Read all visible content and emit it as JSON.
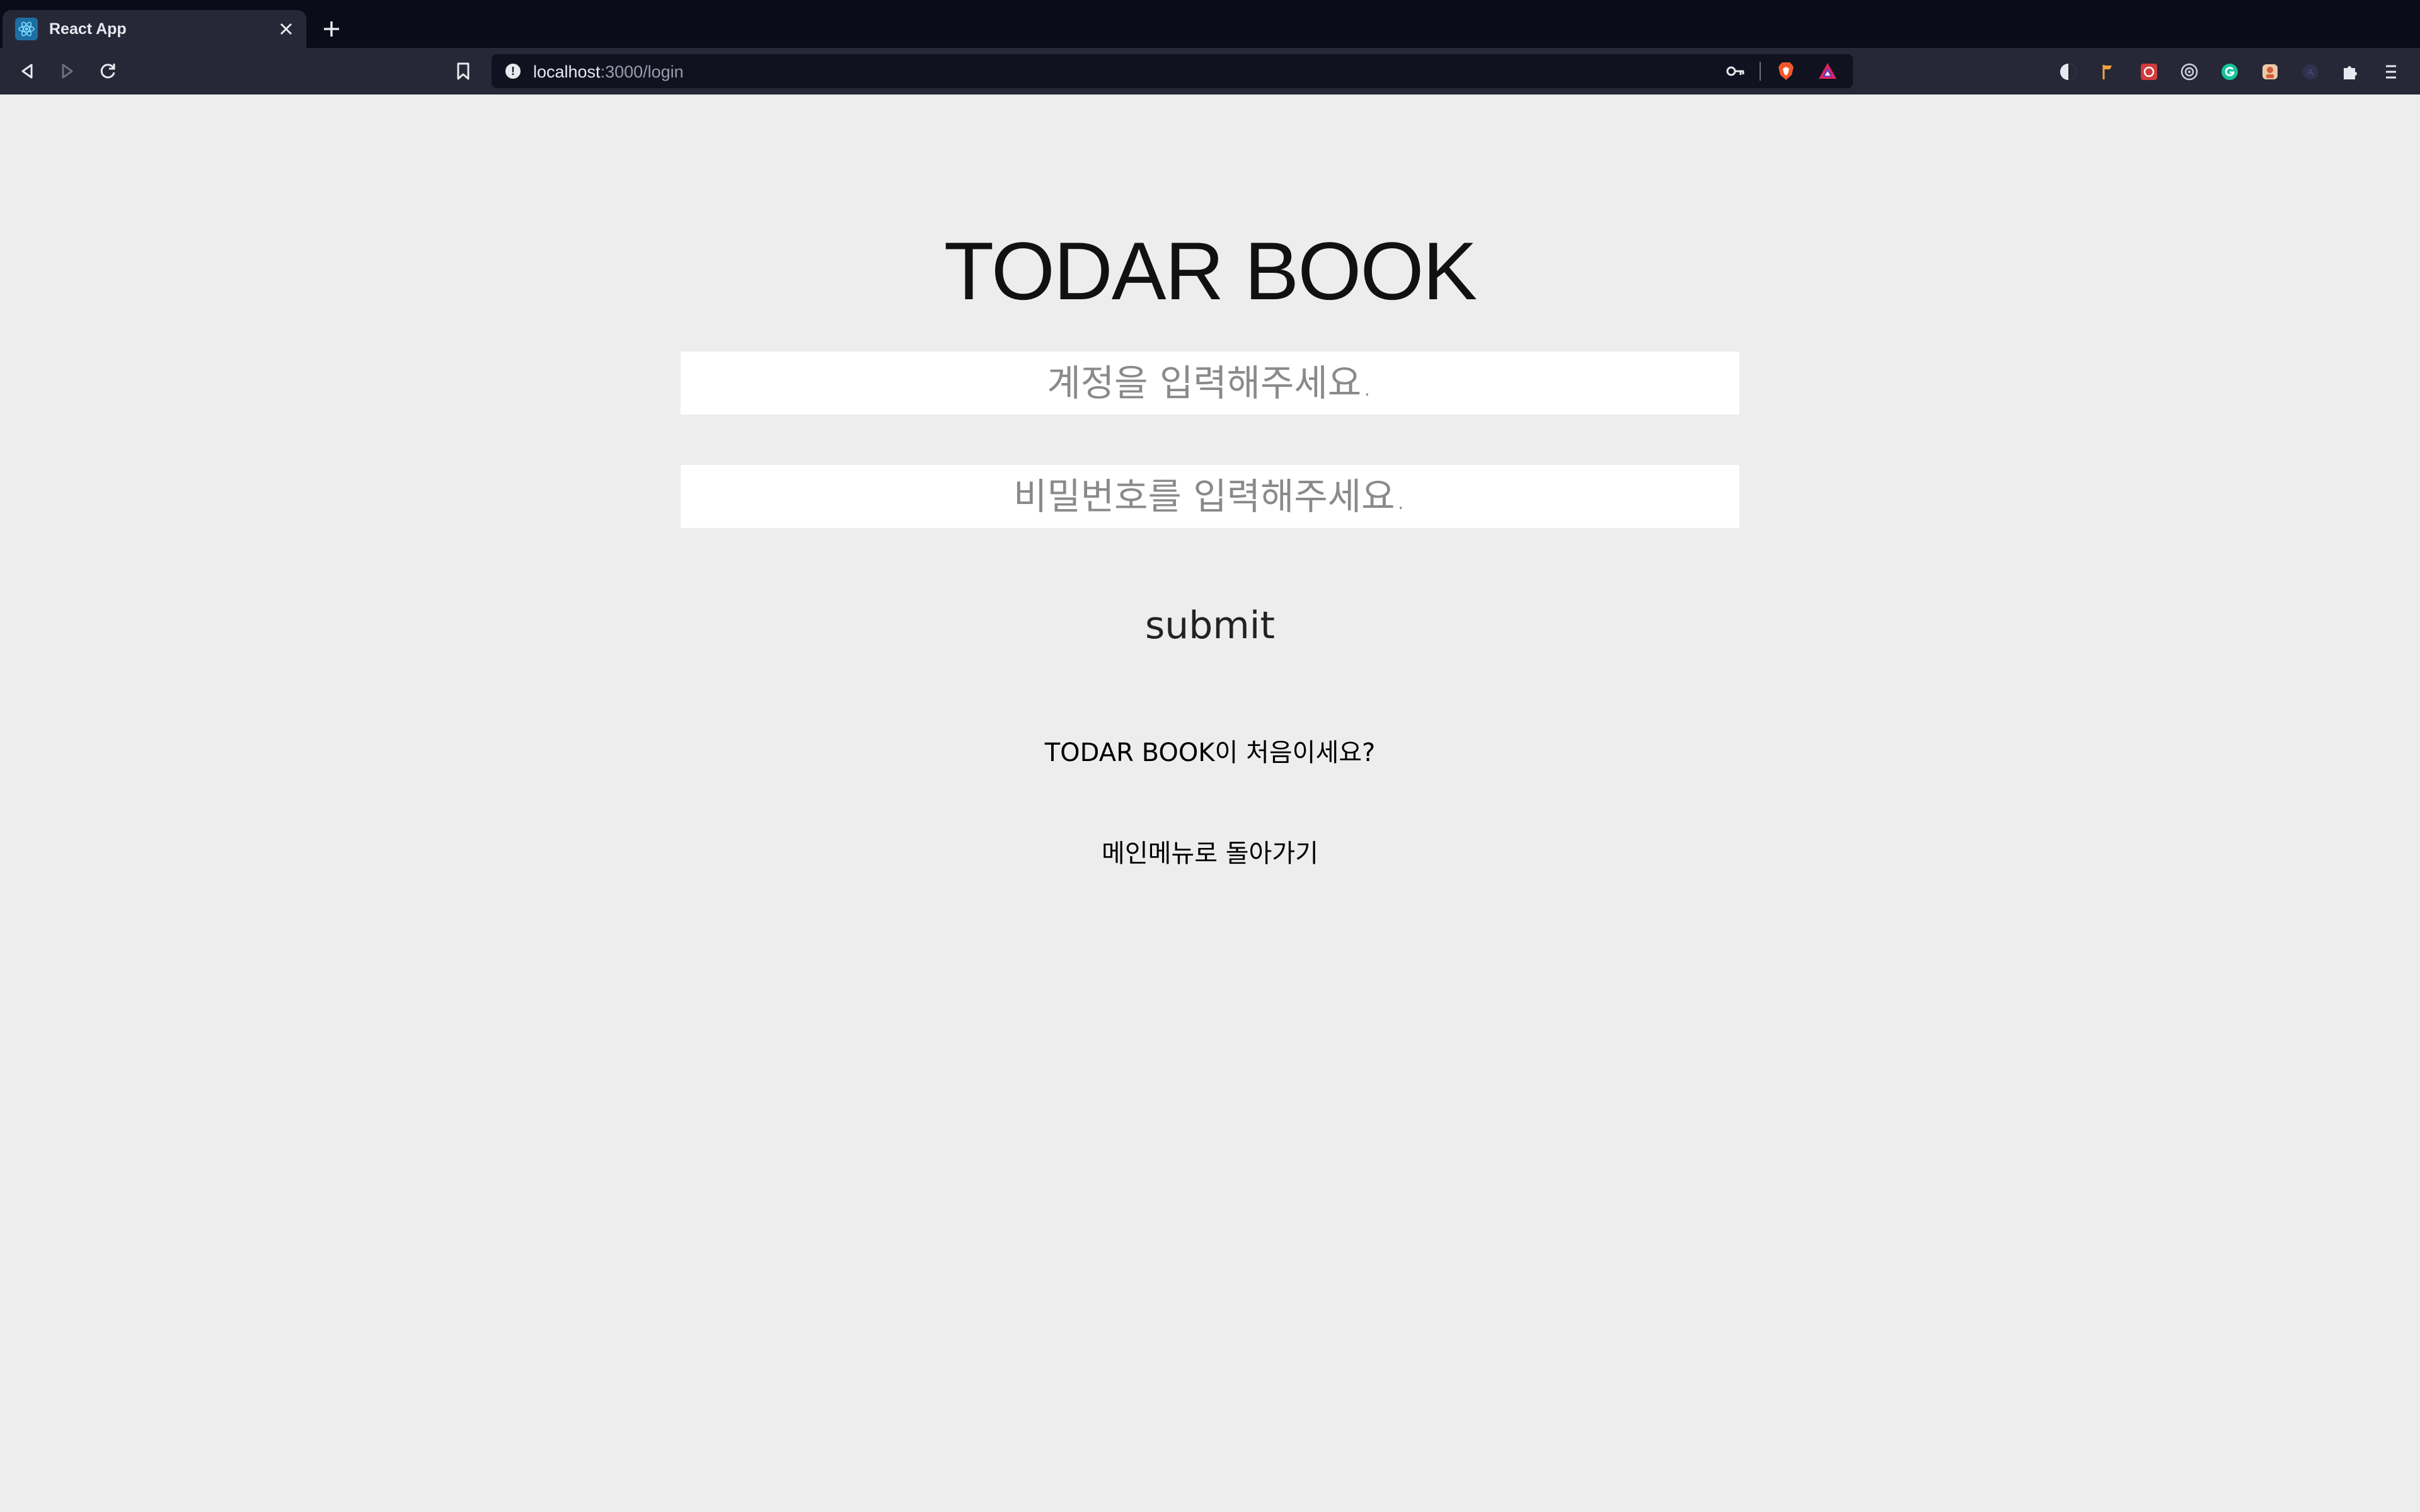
{
  "browser": {
    "tab": {
      "title": "React App"
    },
    "address": {
      "host": "localhost",
      "path": ":3000/login"
    }
  },
  "page": {
    "logo": "TODAR BOOK",
    "account_input": {
      "placeholder": "계정을 입력해주세요."
    },
    "password_input": {
      "placeholder": "비밀번호를 입력해주세요."
    },
    "submit_label": "submit",
    "signup_link": "TODAR BOOK이 처음이세요?",
    "main_menu_link": "메인메뉴로 돌아가기"
  },
  "icons": {
    "tab_favicon": "react-icon",
    "tab_close": "close-icon",
    "new_tab": "plus-icon",
    "back": "back-icon",
    "forward": "forward-icon",
    "reload": "reload-icon",
    "bookmark": "bookmark-icon",
    "site_info": "info-icon",
    "password_key": "key-icon",
    "brave_shields": "brave-lion-icon",
    "brave_rewards": "brave-rewards-icon",
    "extensions": "puzzle-icon",
    "menu": "hamburger-icon"
  },
  "colors": {
    "page_background": "#ededed",
    "tabstrip": "#0b0c18",
    "toolbar": "#262838",
    "omnibox": "#101220"
  }
}
